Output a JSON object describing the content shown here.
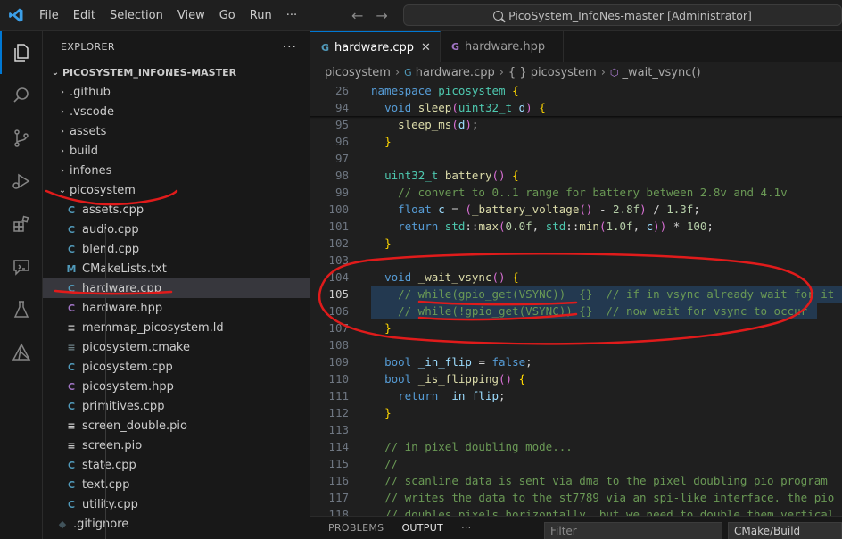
{
  "titlebar": {
    "menu": [
      "File",
      "Edit",
      "Selection",
      "View",
      "Go",
      "Run",
      "···"
    ],
    "search_text": "PicoSystem_InfoNes-master [Administrator]"
  },
  "activity_icons": [
    "explorer-icon",
    "search-icon",
    "source-control-icon",
    "run-debug-icon",
    "extensions-icon",
    "chat-icon",
    "testing-icon",
    "cmake-icon"
  ],
  "sidebar": {
    "title": "EXPLORER",
    "more": "···",
    "root": "PICOSYSTEM_INFONES-MASTER",
    "items": [
      {
        "label": ".github",
        "kind": "folder",
        "chev": "›"
      },
      {
        "label": ".vscode",
        "kind": "folder",
        "chev": "›"
      },
      {
        "label": "assets",
        "kind": "folder",
        "chev": "›"
      },
      {
        "label": "build",
        "kind": "folder",
        "chev": "›"
      },
      {
        "label": "infones",
        "kind": "folder",
        "chev": "›"
      },
      {
        "label": "picosystem",
        "kind": "folder-open",
        "chev": "⌄"
      },
      {
        "label": "assets.cpp",
        "kind": "cpp",
        "icon": "C"
      },
      {
        "label": "audio.cpp",
        "kind": "cpp",
        "icon": "C"
      },
      {
        "label": "blend.cpp",
        "kind": "cpp",
        "icon": "C"
      },
      {
        "label": "CMakeLists.txt",
        "kind": "cmake",
        "icon": "M"
      },
      {
        "label": "hardware.cpp",
        "kind": "cpp",
        "icon": "C",
        "selected": true
      },
      {
        "label": "hardware.hpp",
        "kind": "hpp",
        "icon": "C"
      },
      {
        "label": "memmap_picosystem.ld",
        "kind": "ld",
        "icon": "≡"
      },
      {
        "label": "picosystem.cmake",
        "kind": "cm",
        "icon": "≡"
      },
      {
        "label": "picosystem.cpp",
        "kind": "cpp",
        "icon": "C"
      },
      {
        "label": "picosystem.hpp",
        "kind": "hpp",
        "icon": "C"
      },
      {
        "label": "primitives.cpp",
        "kind": "cpp",
        "icon": "C"
      },
      {
        "label": "screen_double.pio",
        "kind": "ld",
        "icon": "≡"
      },
      {
        "label": "screen.pio",
        "kind": "ld",
        "icon": "≡"
      },
      {
        "label": "state.cpp",
        "kind": "cpp",
        "icon": "C"
      },
      {
        "label": "text.cpp",
        "kind": "cpp",
        "icon": "C"
      },
      {
        "label": "utility.cpp",
        "kind": "cpp",
        "icon": "C"
      },
      {
        "label": ".gitignore",
        "kind": "git",
        "icon": "◆"
      }
    ]
  },
  "tabs": [
    {
      "label": "hardware.cpp",
      "active": true,
      "close": "✕"
    },
    {
      "label": "hardware.hpp",
      "active": false
    }
  ],
  "breadcrumb": [
    "picosystem",
    "hardware.cpp",
    "{ } picosystem",
    "_wait_vsync()"
  ],
  "code_lines": [
    {
      "n": "26",
      "text": "namespace picosystem {"
    },
    {
      "n": "94",
      "text": "  void sleep(uint32_t d) {"
    },
    {
      "n": "95",
      "text": "    sleep_ms(d);"
    },
    {
      "n": "96",
      "text": "  }"
    },
    {
      "n": "97",
      "text": ""
    },
    {
      "n": "98",
      "text": "  uint32_t battery() {"
    },
    {
      "n": "99",
      "text": "    // convert to 0..1 range for battery between 2.8v and 4.1v"
    },
    {
      "n": "100",
      "text": "    float c = (_battery_voltage() - 2.8f) / 1.3f;"
    },
    {
      "n": "101",
      "text": "    return std::max(0.0f, std::min(1.0f, c)) * 100;"
    },
    {
      "n": "102",
      "text": "  }"
    },
    {
      "n": "103",
      "text": ""
    },
    {
      "n": "104",
      "text": "  void _wait_vsync() {"
    },
    {
      "n": "105",
      "text": "    // while(gpio_get(VSYNC))  {}  // if in vsync already wait for it"
    },
    {
      "n": "106",
      "text": "    // while(!gpio_get(VSYNC)) {}  // now wait for vsync to occur"
    },
    {
      "n": "107",
      "text": "  }"
    },
    {
      "n": "108",
      "text": ""
    },
    {
      "n": "109",
      "text": "  bool _in_flip = false;"
    },
    {
      "n": "110",
      "text": "  bool _is_flipping() {"
    },
    {
      "n": "111",
      "text": "    return _in_flip;"
    },
    {
      "n": "112",
      "text": "  }"
    },
    {
      "n": "113",
      "text": ""
    },
    {
      "n": "114",
      "text": "  // in pixel doubling mode..."
    },
    {
      "n": "115",
      "text": "  //"
    },
    {
      "n": "116",
      "text": "  // scanline data is sent via dma to the pixel doubling pio program"
    },
    {
      "n": "117",
      "text": "  // writes the data to the st7789 via an spi-like interface. the pio"
    },
    {
      "n": "118",
      "text": "  // doubles pixels horizontally, but we need to double them vertical"
    }
  ],
  "panel": {
    "tabs": [
      "PROBLEMS",
      "OUTPUT",
      "···"
    ],
    "filter_placeholder": "Filter",
    "output_channel": "CMake/Build"
  },
  "colors": {
    "accent": "#0078d4",
    "annotation": "#e01b1b"
  }
}
